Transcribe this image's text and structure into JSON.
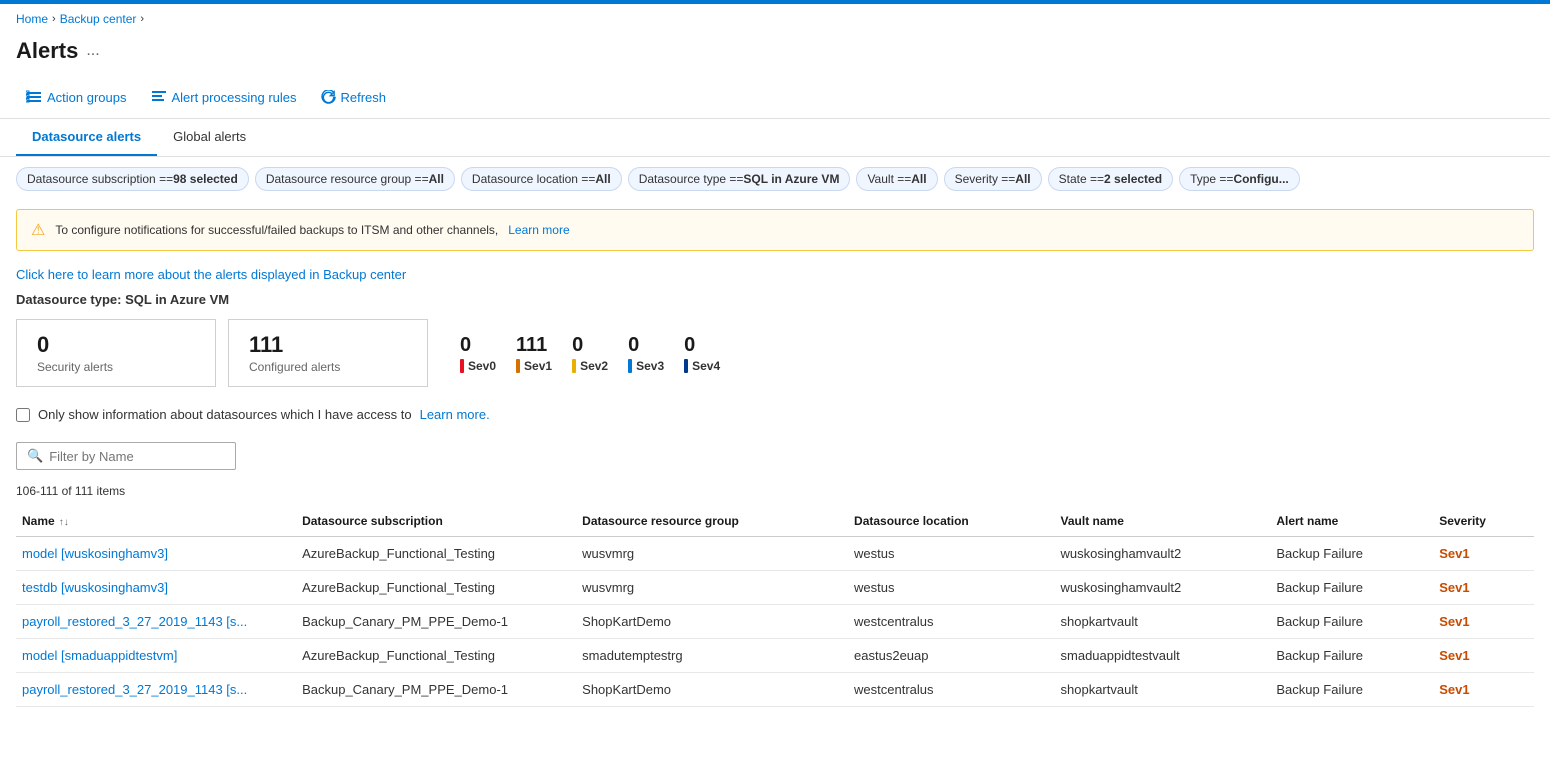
{
  "breadcrumb": {
    "home": "Home",
    "backup_center": "Backup center",
    "current": "Alerts"
  },
  "page": {
    "title": "Alerts",
    "more_label": "..."
  },
  "toolbar": {
    "action_groups_label": "Action groups",
    "alert_processing_rules_label": "Alert processing rules",
    "refresh_label": "Refresh"
  },
  "tabs": [
    {
      "id": "datasource",
      "label": "Datasource alerts",
      "active": true
    },
    {
      "id": "global",
      "label": "Global alerts",
      "active": false
    }
  ],
  "filters": [
    {
      "prefix": "Datasource subscription == ",
      "value": "98 selected"
    },
    {
      "prefix": "Datasource resource group == ",
      "value": "All"
    },
    {
      "prefix": "Datasource location == ",
      "value": "All"
    },
    {
      "prefix": "Datasource type == ",
      "value": "SQL in Azure VM"
    },
    {
      "prefix": "Vault == ",
      "value": "All"
    },
    {
      "prefix": "Severity == ",
      "value": "All"
    },
    {
      "prefix": "State == ",
      "value": "2 selected"
    },
    {
      "prefix": "Type == ",
      "value": "Configu..."
    }
  ],
  "warning": {
    "message": "To configure notifications for successful/failed backups to ITSM and other channels,",
    "link_text": "Learn more"
  },
  "learn_more": {
    "text": "Click here to learn more about the alerts displayed in Backup center"
  },
  "datasource_label": "Datasource type: SQL in Azure VM",
  "metrics": {
    "security_alerts_value": "0",
    "security_alerts_label": "Security alerts",
    "configured_alerts_value": "111",
    "configured_alerts_label": "Configured alerts",
    "sev_items": [
      {
        "id": "sev0",
        "value": "0",
        "label": "Sev0",
        "color": "#e81123"
      },
      {
        "id": "sev1",
        "value": "111",
        "label": "Sev1",
        "color": "#d47200"
      },
      {
        "id": "sev2",
        "value": "0",
        "label": "Sev2",
        "color": "#eab000"
      },
      {
        "id": "sev3",
        "value": "0",
        "label": "Sev3",
        "color": "#0078d4"
      },
      {
        "id": "sev4",
        "value": "0",
        "label": "Sev4",
        "color": "#003a8c"
      }
    ]
  },
  "checkbox": {
    "label": "Only show information about datasources which I have access to",
    "link_text": "Learn more."
  },
  "search": {
    "placeholder": "Filter by Name"
  },
  "items_count": "106-111 of 111 items",
  "table": {
    "columns": [
      {
        "id": "name",
        "label": "Name",
        "sortable": true
      },
      {
        "id": "subscription",
        "label": "Datasource subscription",
        "sortable": false
      },
      {
        "id": "resource_group",
        "label": "Datasource resource group",
        "sortable": false
      },
      {
        "id": "location",
        "label": "Datasource location",
        "sortable": false
      },
      {
        "id": "vault_name",
        "label": "Vault name",
        "sortable": false
      },
      {
        "id": "alert_name",
        "label": "Alert name",
        "sortable": false
      },
      {
        "id": "severity",
        "label": "Severity",
        "sortable": false
      }
    ],
    "rows": [
      {
        "name": "model [wuskosinghamv3]",
        "subscription": "AzureBackup_Functional_Testing",
        "resource_group": "wusvmrg",
        "location": "westus",
        "vault_name": "wuskosinghamvault2",
        "alert_name": "Backup Failure",
        "severity": "Sev1"
      },
      {
        "name": "testdb [wuskosinghamv3]",
        "subscription": "AzureBackup_Functional_Testing",
        "resource_group": "wusvmrg",
        "location": "westus",
        "vault_name": "wuskosinghamvault2",
        "alert_name": "Backup Failure",
        "severity": "Sev1"
      },
      {
        "name": "payroll_restored_3_27_2019_1143 [s...",
        "subscription": "Backup_Canary_PM_PPE_Demo-1",
        "resource_group": "ShopKartDemo",
        "location": "westcentralus",
        "vault_name": "shopkartvault",
        "alert_name": "Backup Failure",
        "severity": "Sev1"
      },
      {
        "name": "model [smaduappidtestvm]",
        "subscription": "AzureBackup_Functional_Testing",
        "resource_group": "smadutemptestrg",
        "location": "eastus2euap",
        "vault_name": "smaduappidtestvault",
        "alert_name": "Backup Failure",
        "severity": "Sev1"
      },
      {
        "name": "payroll_restored_3_27_2019_1143 [s...",
        "subscription": "Backup_Canary_PM_PPE_Demo-1",
        "resource_group": "ShopKartDemo",
        "location": "westcentralus",
        "vault_name": "shopkartvault",
        "alert_name": "Backup Failure",
        "severity": "Sev1"
      }
    ]
  }
}
